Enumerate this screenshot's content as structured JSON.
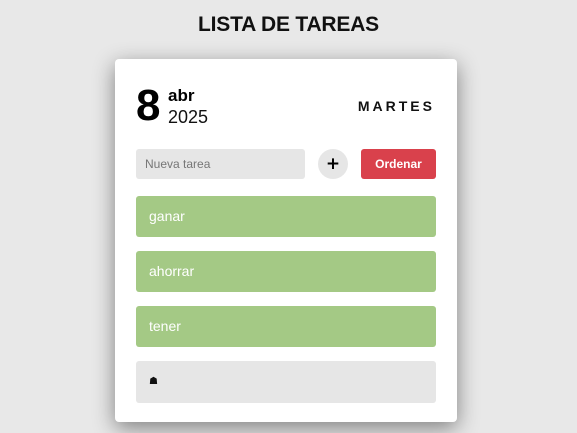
{
  "page": {
    "title": "LISTA DE TAREAS"
  },
  "date": {
    "day": "8",
    "month": "abr",
    "year": "2025",
    "weekday": "MARTES"
  },
  "form": {
    "input_value": "",
    "input_placeholder": "Nueva tarea",
    "add_label": "+",
    "sort_label": "Ordenar"
  },
  "tasks": [
    {
      "text": "ganar"
    },
    {
      "text": "ahorrar"
    },
    {
      "text": "tener"
    }
  ],
  "empty_item": {
    "icon": "house-icon",
    "glyph": "☗"
  },
  "colors": {
    "background": "#e8e8e8",
    "card": "#ffffff",
    "task_done": "#a4c985",
    "task_empty": "#e6e6e6",
    "accent": "#d9414c"
  }
}
